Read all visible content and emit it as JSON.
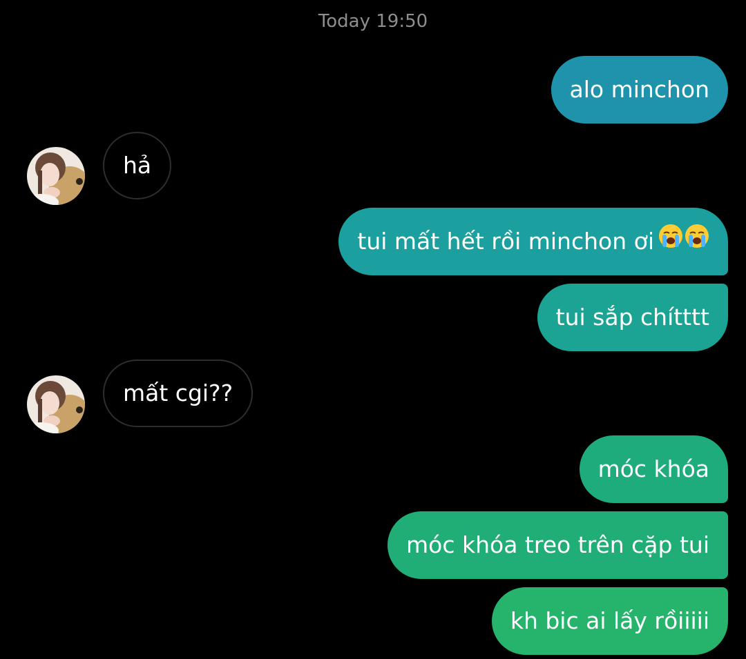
{
  "chat": {
    "timestamp": "Today 19:50",
    "messages": [
      {
        "from": "me",
        "text": "alo minchon",
        "color": "#1f93ab"
      },
      {
        "from": "them",
        "text": "hả"
      },
      {
        "from": "me",
        "text": "tui mất hết rồi minchon ơi",
        "emojis": [
          "loudly-crying-face",
          "loudly-crying-face"
        ],
        "color": "#1b9f9f"
      },
      {
        "from": "me",
        "text": "tui sắp chítttt",
        "color": "#1ba494"
      },
      {
        "from": "them",
        "text": "mất cgi??"
      },
      {
        "from": "me",
        "text": "móc khóa",
        "color": "#1eac7c"
      },
      {
        "from": "me",
        "text": "móc khóa treo trên cặp tui",
        "color": "#21ae76"
      },
      {
        "from": "me",
        "text": "kh bic ai lấy rồiiiii",
        "color": "#26b46c"
      }
    ]
  },
  "colors": {
    "background": "#000000",
    "incoming_border": "#2e2e2e",
    "timestamp": "#8e8e8e",
    "text": "#ffffff"
  }
}
